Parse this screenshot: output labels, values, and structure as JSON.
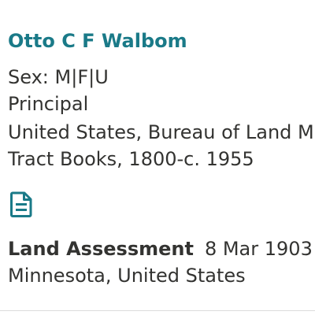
{
  "record": {
    "name": "Otto C F Walbom",
    "sex_label": "Sex:",
    "sex_options": [
      "M",
      "F",
      "U"
    ],
    "sex_separator": "|",
    "role": "Principal",
    "collection_line1": "United States, Bureau of Land Management,",
    "collection_line2": "Tract Books, 1800-c. 1955",
    "icon": "document-icon",
    "event": {
      "type": "Land Assessment",
      "date": "8 Mar 1903",
      "place": "Minnesota, United States"
    }
  },
  "colors": {
    "name_link": "#1a7a88",
    "text": "#333331",
    "icon": "#1a7a88"
  }
}
